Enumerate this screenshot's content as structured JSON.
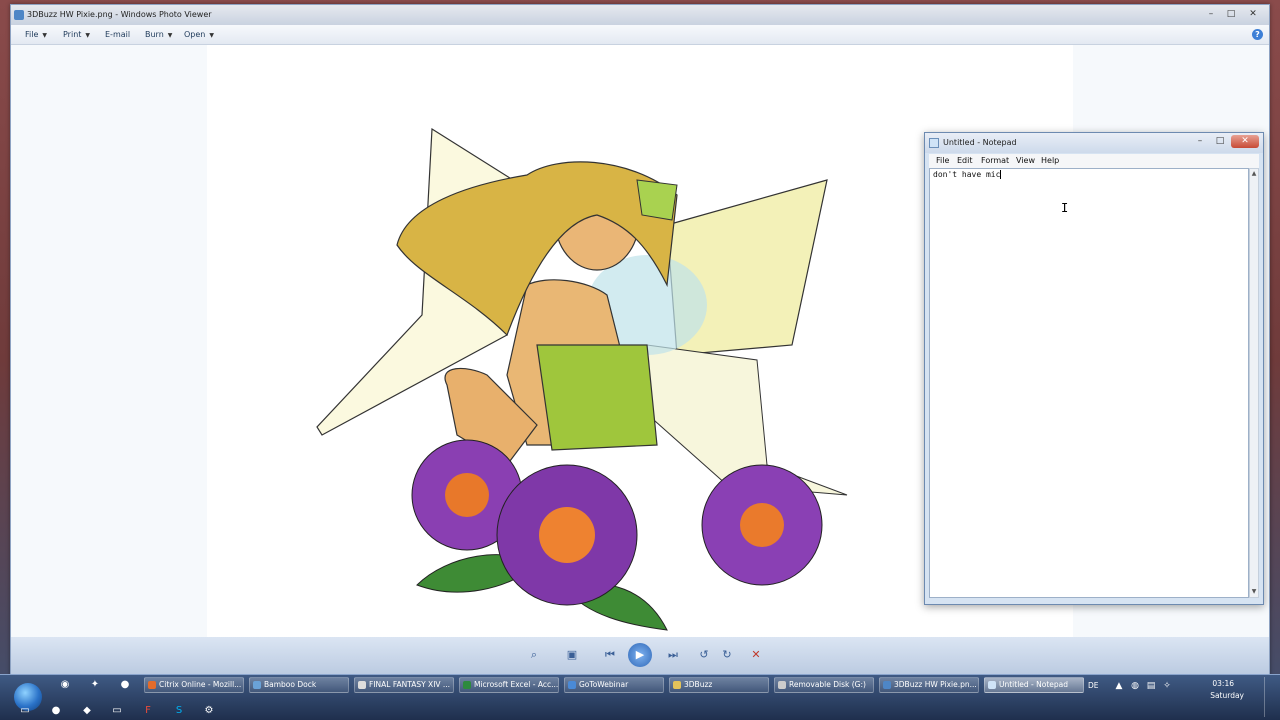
{
  "photo_viewer": {
    "title": "3DBuzz HW Pixie.png - Windows Photo Viewer",
    "menu": [
      {
        "name": "file",
        "label": "File"
      },
      {
        "name": "print",
        "label": "Print"
      },
      {
        "name": "email",
        "label": "E-mail"
      },
      {
        "name": "burn",
        "label": "Burn"
      },
      {
        "name": "open",
        "label": "Open"
      }
    ],
    "help_label": "?"
  },
  "notepad": {
    "title": "Untitled - Notepad",
    "menu": [
      {
        "name": "file",
        "label": "File"
      },
      {
        "name": "edit",
        "label": "Edit"
      },
      {
        "name": "format",
        "label": "Format"
      },
      {
        "name": "view",
        "label": "View"
      },
      {
        "name": "help",
        "label": "Help"
      }
    ],
    "text": "don't have mic"
  },
  "taskbar": {
    "tasks": [
      {
        "label": "Citrix Online - Mozill...",
        "color": "#e36c2b"
      },
      {
        "label": "Bamboo Dock",
        "color": "#6aa2d8"
      },
      {
        "label": "FINAL FANTASY XIV ...",
        "color": "#dddddd"
      },
      {
        "label": "Microsoft Excel - Acc...",
        "color": "#2d8a3e"
      },
      {
        "label": "GoToWebinar",
        "color": "#4a8ad6"
      },
      {
        "label": "3DBuzz",
        "color": "#e3c35a"
      },
      {
        "label": "Removable Disk (G:)",
        "color": "#cccccc"
      },
      {
        "label": "3DBuzz HW Pixie.pn...",
        "color": "#4e86c6"
      },
      {
        "label": "Untitled - Notepad",
        "color": "#cfe3f7"
      }
    ],
    "tray": {
      "language": "DE",
      "time": "03:16",
      "day": "Saturday"
    }
  },
  "colors": {
    "taskbar": "#2a3f63",
    "notepad_close": "#c74a36",
    "toolbar": "#c9d7ea"
  }
}
